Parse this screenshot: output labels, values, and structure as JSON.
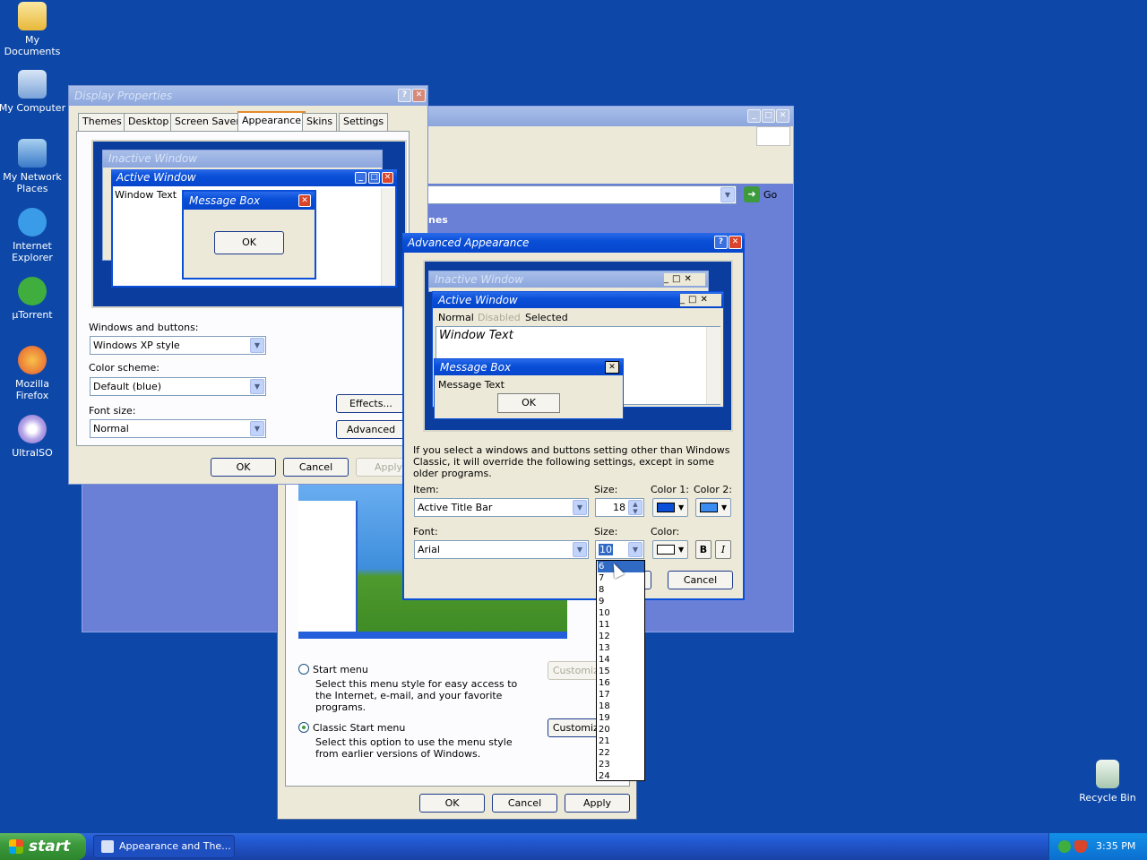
{
  "desktop": {
    "icons": [
      {
        "label": "My Documents",
        "icon": "folder-icon"
      },
      {
        "label": "My Computer",
        "icon": "computer-icon"
      },
      {
        "label": "My Network Places",
        "icon": "network-icon"
      },
      {
        "label": "Internet Explorer",
        "icon": "ie-icon"
      },
      {
        "label": "µTorrent",
        "icon": "utorrent-icon"
      },
      {
        "label": "Mozilla Firefox",
        "icon": "firefox-icon"
      },
      {
        "label": "UltraISO",
        "icon": "disc-icon"
      },
      {
        "label": "Recycle Bin",
        "icon": "recycle-icon"
      }
    ]
  },
  "explorer": {
    "go_label": "Go",
    "partial_text": "nes"
  },
  "taskbar_props": {
    "start_menu_label": "Start menu",
    "start_menu_desc": "Select this menu style for easy access to the Internet, e-mail, and your favorite programs.",
    "classic_label": "Classic Start menu",
    "classic_desc": "Select this option to use the menu style from earlier versions of Windows.",
    "customize_label": "Customize...",
    "ok": "OK",
    "cancel": "Cancel",
    "apply": "Apply"
  },
  "display": {
    "title": "Display Properties",
    "tabs": [
      "Themes",
      "Desktop",
      "Screen Saver",
      "Appearance",
      "Skins",
      "Settings"
    ],
    "preview": {
      "inactive": "Inactive Window",
      "active": "Active Window",
      "window_text": "Window Text",
      "message_box": "Message Box",
      "ok": "OK"
    },
    "windows_buttons_label": "Windows and buttons:",
    "windows_buttons_value": "Windows XP style",
    "color_scheme_label": "Color scheme:",
    "color_scheme_value": "Default (blue)",
    "font_size_label": "Font size:",
    "font_size_value": "Normal",
    "effects": "Effects...",
    "advanced": "Advanced",
    "ok": "OK",
    "cancel": "Cancel",
    "apply": "Apply"
  },
  "advanced": {
    "title": "Advanced Appearance",
    "preview": {
      "inactive": "Inactive Window",
      "active": "Active Window",
      "menu_normal": "Normal",
      "menu_disabled": "Disabled",
      "menu_selected": "Selected",
      "window_text": "Window Text",
      "message_box": "Message Box",
      "message_text": "Message Text",
      "ok": "OK"
    },
    "note": "If you select a windows and buttons setting other than Windows Classic, it will override the following settings, except in some older programs.",
    "item_label": "Item:",
    "item_value": "Active Title Bar",
    "size_label": "Size:",
    "size_value": "18",
    "color1_label": "Color 1:",
    "color2_label": "Color 2:",
    "font_label": "Font:",
    "font_value": "Arial",
    "font_size_label": "Size:",
    "font_size_value": "10",
    "color_label": "Color:",
    "bold": "B",
    "italic": "I",
    "cancel": "Cancel",
    "size_options": [
      "6",
      "7",
      "8",
      "9",
      "10",
      "11",
      "12",
      "13",
      "14",
      "15",
      "16",
      "17",
      "18",
      "19",
      "20",
      "21",
      "22",
      "23",
      "24"
    ]
  },
  "taskbar": {
    "start": "start",
    "task_label": "Appearance and The...",
    "clock": "3:35 PM"
  },
  "colors": {
    "desktop": "#0d48a8",
    "titlebar": "#0a4fd8",
    "color1": "#0a4fd8",
    "color2": "#3a8cf0"
  }
}
